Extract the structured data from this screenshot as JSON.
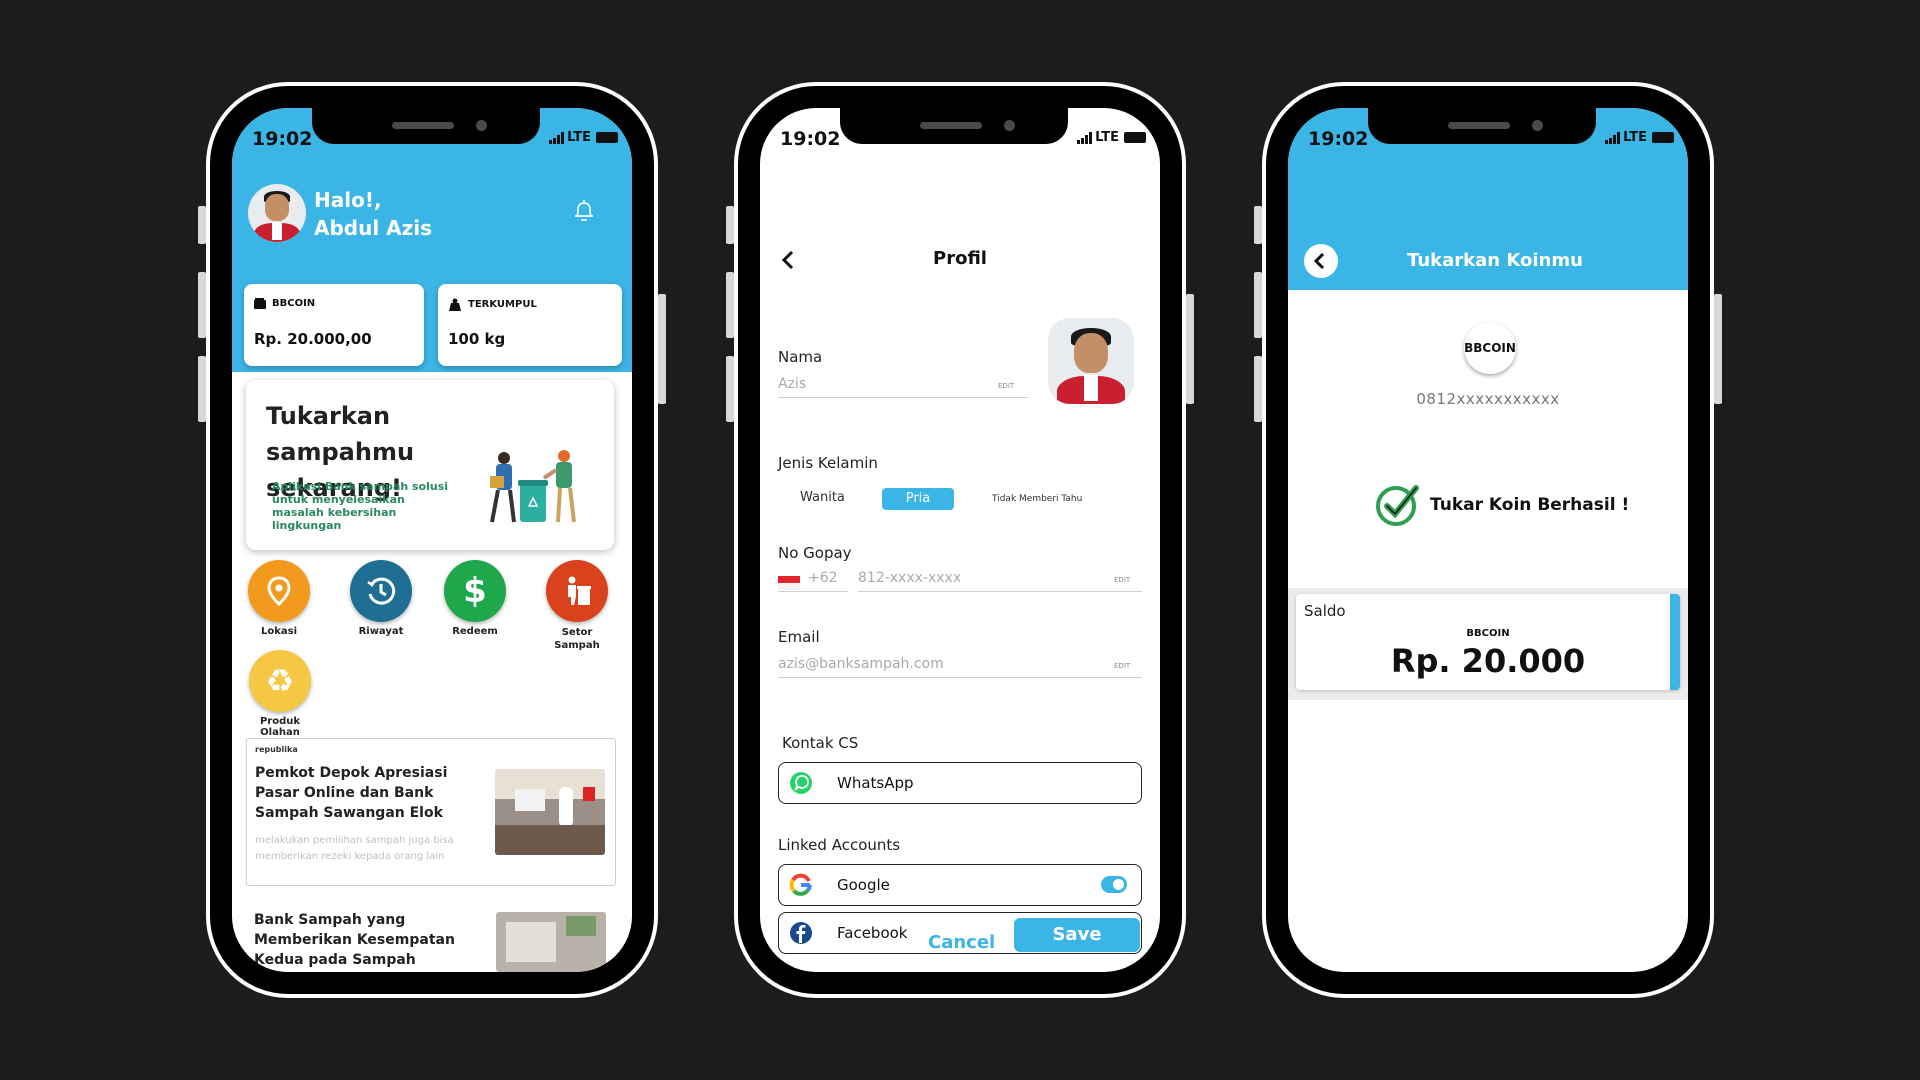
{
  "status": {
    "time": "19:02",
    "network": "LTE"
  },
  "home": {
    "greeting_line1": "Halo!,",
    "greeting_line2": "Abdul Azis",
    "cards": [
      {
        "label": "BBCOIN",
        "value": "Rp. 20.000,00"
      },
      {
        "label": "TERKUMPUL",
        "value": "100 kg"
      }
    ],
    "promo": {
      "title": "Tukarkan sampahmu sekarang!",
      "description": "Aplikasi Bank sampah solusi untuk menyelesaikan masalah kebersihan lingkungan"
    },
    "menu": [
      {
        "label": "Lokasi",
        "icon": "location-pin-icon",
        "color": "#f29a1d"
      },
      {
        "label": "Riwayat",
        "icon": "history-clock-icon",
        "color": "#1f6e93"
      },
      {
        "label": "Redeem",
        "icon": "dollar-icon",
        "color": "#1fa84b"
      },
      {
        "label": "Setor Sampah",
        "icon": "trash-deposit-icon",
        "color": "#d9421c"
      },
      {
        "label": "Produk Olahan",
        "icon": "recycle-icon",
        "color": "#f6c744"
      }
    ],
    "news": [
      {
        "source": "republika",
        "title": "Pemkot Depok Apresiasi Pasar Online dan Bank Sampah Sawangan Elok",
        "subtitle": "melakukan pemilihan sampah juga bisa memberikan rezeki kepada orang lain"
      },
      {
        "title": "Bank Sampah yang Memberikan Kesempatan Kedua pada Sampah"
      }
    ]
  },
  "profile": {
    "title": "Profil",
    "name_label": "Nama",
    "name_value": "Azis",
    "edit_label": "EDIT",
    "gender_label": "Jenis Kelamin",
    "gender_options": [
      "Wanita",
      "Pria",
      "Tidak Memberi Tahu"
    ],
    "gender_selected": "Pria",
    "gopay_label": "No Gopay",
    "country_code": "+62",
    "gopay_placeholder": "812-xxxx-xxxx",
    "email_label": "Email",
    "email_value": "azis@banksampah.com",
    "cs_label": "Kontak CS",
    "cs_whatsapp": "WhatsApp",
    "linked_label": "Linked Accounts",
    "accounts": [
      {
        "name": "Google",
        "enabled": true
      },
      {
        "name": "Facebook",
        "enabled": false
      }
    ],
    "cancel": "Cancel",
    "save": "Save"
  },
  "exchange": {
    "title": "Tukarkan Koinmu",
    "coin_label": "BBCOIN",
    "phone": "0812xxxxxxxxxxx",
    "success": "Tukar Koin Berhasil !",
    "saldo_label": "Saldo",
    "saldo_coin": "BBCOIN",
    "saldo_amount": "Rp. 20.000"
  },
  "colors": {
    "primary": "#3bb5e6",
    "background": "#1c1c1c",
    "success": "#2e9f4f"
  }
}
